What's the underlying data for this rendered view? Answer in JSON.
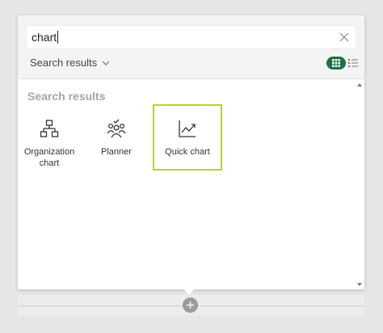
{
  "search": {
    "value": "chart"
  },
  "header": {
    "dropdown_label": "Search results"
  },
  "results": {
    "section_title": "Search results",
    "items": [
      {
        "label": "Organization chart",
        "icon": "org-chart-icon"
      },
      {
        "label": "Planner",
        "icon": "planner-icon"
      },
      {
        "label": "Quick chart",
        "icon": "line-chart-icon",
        "selected": true
      }
    ]
  },
  "colors": {
    "toggle_active": "#1e7145",
    "selection_border": "#b5d334",
    "section_title": "#a6a6a6"
  }
}
